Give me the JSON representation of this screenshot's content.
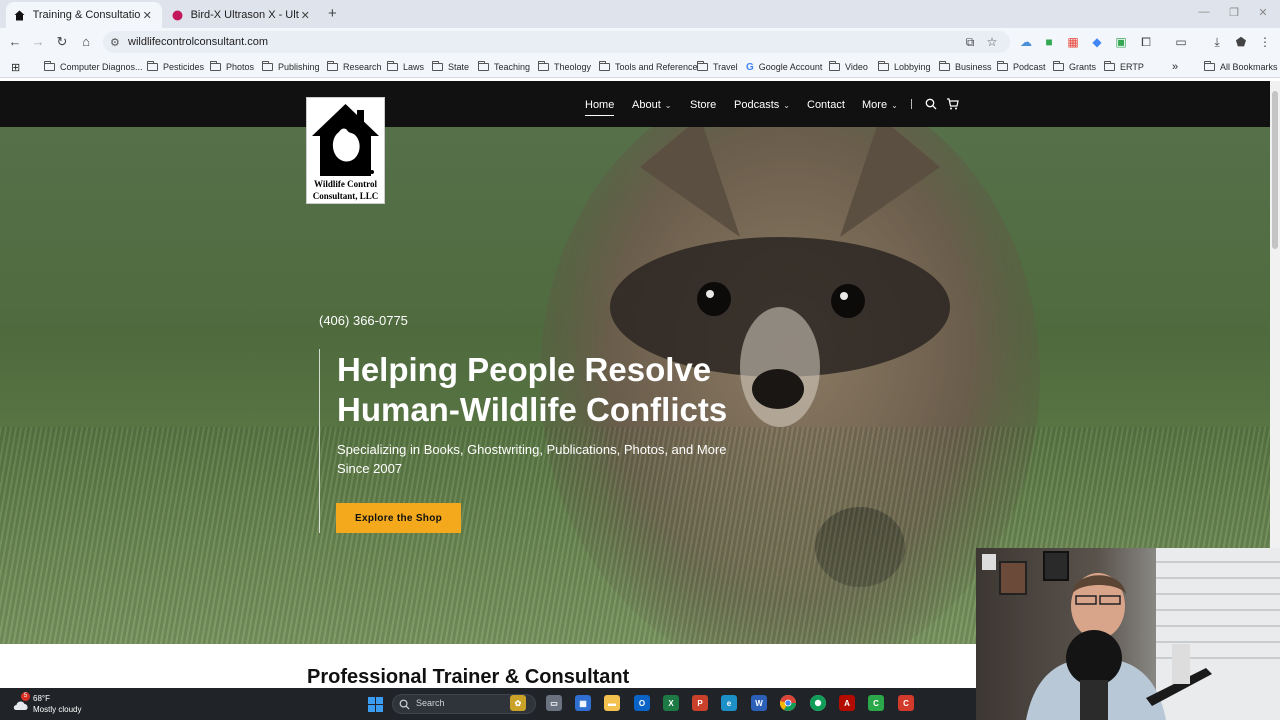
{
  "browser": {
    "tabs": [
      {
        "title": "Training & Consultation - Wildl",
        "active": true
      },
      {
        "title": "Bird-X Ultrason X - Ultrasonic B",
        "active": false
      }
    ],
    "url": "wildlifecontrolconsultant.com",
    "bookmarks": [
      "Computer Diagnos...",
      "Pesticides",
      "Photos",
      "Publishing",
      "Research",
      "Laws",
      "State",
      "Teaching",
      "Theology",
      "Tools and Reference",
      "Travel",
      "Google Account",
      "Video",
      "Lobbying",
      "Business",
      "Podcast",
      "Grants",
      "ERTP"
    ],
    "all_bookmarks": "All Bookmarks",
    "icons": [
      "back-icon",
      "forward-icon",
      "reload-icon",
      "home-icon",
      "site-info-icon",
      "install-icon",
      "star-icon",
      "extensions-icon",
      "download-icon",
      "menu-icon"
    ]
  },
  "site": {
    "logo_text": "Wildlife Control Consultant, LLC",
    "nav": [
      "Home",
      "About",
      "Store",
      "Podcasts",
      "Contact",
      "More"
    ],
    "hero": {
      "phone": "(406) 366-0775",
      "headline": "Helping People Resolve Human-Wildlife Conflicts",
      "subhead": "Specializing in Books, Ghostwriting, Publications, Photos, and More Since 2007",
      "cta": "Explore the Shop"
    },
    "section_title": "Professional Trainer & Consultant",
    "colors": {
      "header": "#111111",
      "accent": "#f3a91b"
    }
  },
  "taskbar": {
    "weather_temp": "68°F",
    "weather_condition": "Mostly cloudy",
    "weather_badge": "5",
    "search_placeholder": "Search"
  }
}
